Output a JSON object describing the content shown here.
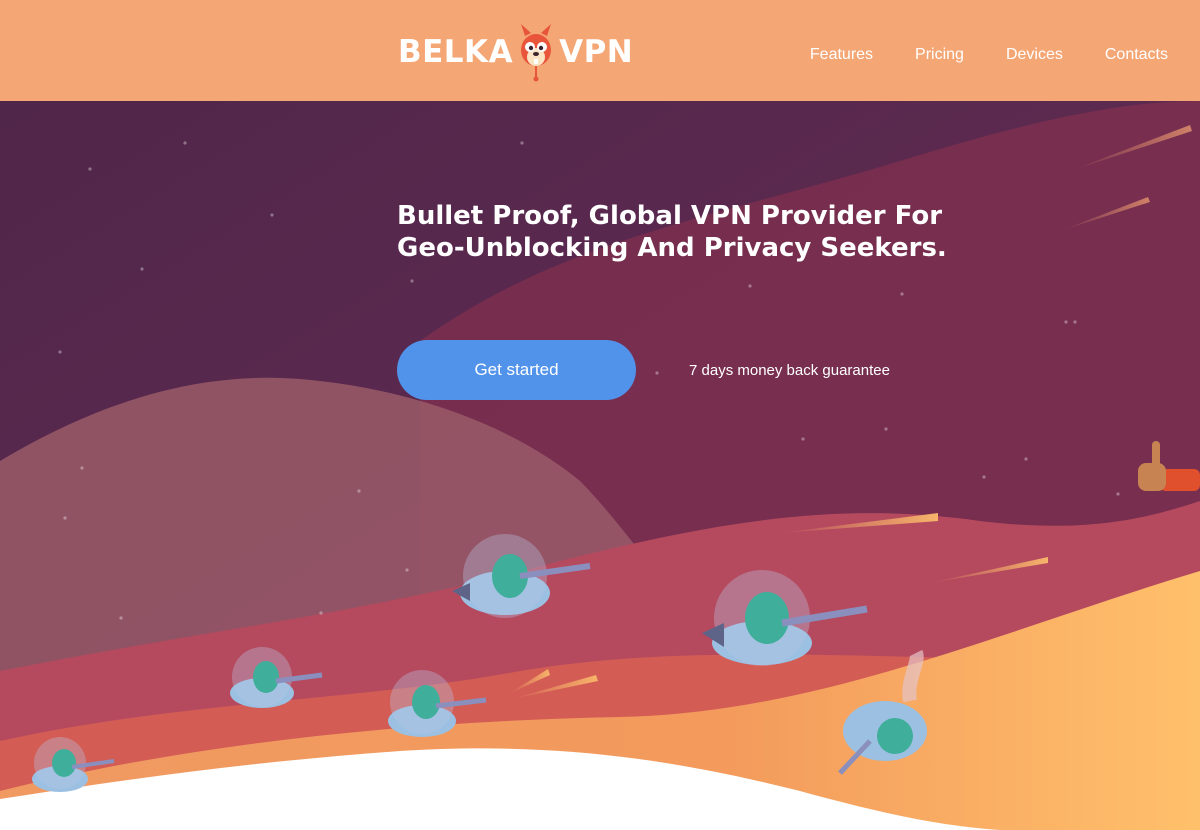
{
  "brand": {
    "left": "BELKA",
    "right": "VPN",
    "mascot_icon": "squirrel-mascot-icon"
  },
  "nav": {
    "items": [
      {
        "label": "Features"
      },
      {
        "label": "Pricing"
      },
      {
        "label": "Devices"
      },
      {
        "label": "Contacts"
      }
    ]
  },
  "hero": {
    "headline_line1": "Bullet Proof, Global VPN Provider For",
    "headline_line2": "Geo-Unblocking And Privacy Seekers.",
    "cta_label": "Get started",
    "guarantee": "7 days money back guarantee"
  },
  "colors": {
    "header": "#f4a675",
    "sky": "#5a2a4b",
    "cta": "#5192ea",
    "text": "#ffffff"
  }
}
